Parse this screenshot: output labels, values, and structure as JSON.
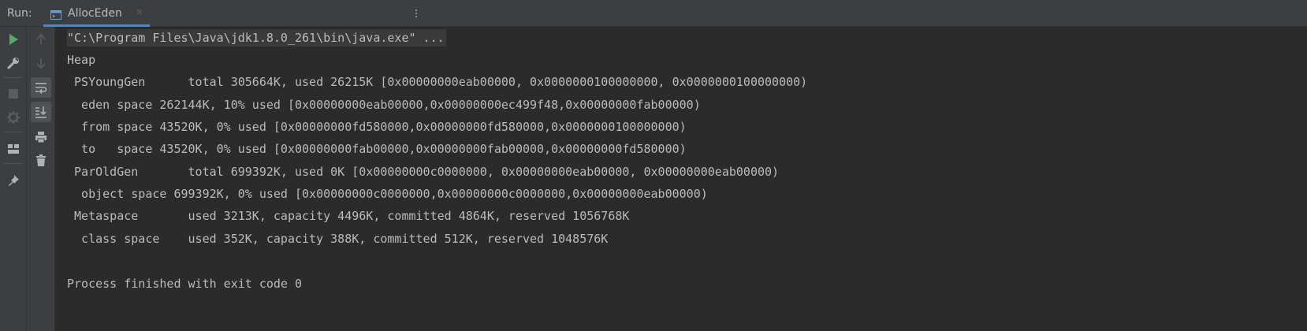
{
  "header": {
    "run_label": "Run:",
    "tab": {
      "title": "AllocEden",
      "icon": "console-run-icon",
      "close_icon": "close-icon"
    }
  },
  "toolbar_primary": [
    {
      "name": "rerun-icon",
      "color": "#59a869"
    },
    {
      "name": "wrench-icon",
      "color": "#afb1b3"
    },
    {
      "name": "stop-icon",
      "color": "#5a5d5f"
    },
    {
      "name": "debug-settings-icon",
      "color": "#5a5d5f"
    },
    {
      "name": "layout-icon",
      "color": "#afb1b3"
    },
    {
      "name": "pin-icon",
      "color": "#afb1b3"
    }
  ],
  "toolbar_secondary": [
    {
      "name": "up-arrow-icon",
      "color": "#5a5d5f"
    },
    {
      "name": "down-arrow-icon",
      "color": "#5a5d5f"
    },
    {
      "name": "soft-wrap-icon",
      "color": "#afb1b3"
    },
    {
      "name": "scroll-to-end-icon",
      "color": "#afb1b3"
    },
    {
      "name": "print-icon",
      "color": "#afb1b3"
    },
    {
      "name": "trash-icon",
      "color": "#afb1b3"
    }
  ],
  "colors": {
    "accent": "#4a88c7",
    "run_green": "#59a869",
    "text": "#bbbbbb",
    "background": "#2b2b2b",
    "toolbar_bg": "#3c3f41"
  },
  "console": {
    "lines": [
      "\"C:\\Program Files\\Java\\jdk1.8.0_261\\bin\\java.exe\" ...",
      "Heap",
      " PSYoungGen      total 305664K, used 26215K [0x00000000eab00000, 0x0000000100000000, 0x0000000100000000)",
      "  eden space 262144K, 10% used [0x00000000eab00000,0x00000000ec499f48,0x00000000fab00000)",
      "  from space 43520K, 0% used [0x00000000fd580000,0x00000000fd580000,0x0000000100000000)",
      "  to   space 43520K, 0% used [0x00000000fab00000,0x00000000fab00000,0x00000000fd580000)",
      " ParOldGen       total 699392K, used 0K [0x00000000c0000000, 0x00000000eab00000, 0x00000000eab00000)",
      "  object space 699392K, 0% used [0x00000000c0000000,0x00000000c0000000,0x00000000eab00000)",
      " Metaspace       used 3213K, capacity 4496K, committed 4864K, reserved 1056768K",
      "  class space    used 352K, capacity 388K, committed 512K, reserved 1048576K",
      "",
      "Process finished with exit code 0"
    ]
  }
}
